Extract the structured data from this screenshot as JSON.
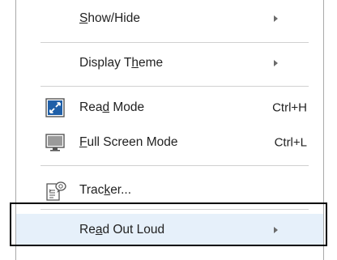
{
  "menu": {
    "items": [
      {
        "label_pre": "",
        "label_u": "S",
        "label_post": "how/Hide",
        "shortcut": "",
        "has_submenu": true,
        "icon": ""
      },
      {
        "label_pre": "Display T",
        "label_u": "h",
        "label_post": "eme",
        "shortcut": "",
        "has_submenu": true,
        "icon": ""
      },
      {
        "label_pre": "Rea",
        "label_u": "d",
        "label_post": " Mode",
        "shortcut": "Ctrl+H",
        "has_submenu": false,
        "icon": "read-mode-icon"
      },
      {
        "label_pre": "",
        "label_u": "F",
        "label_post": "ull Screen Mode",
        "shortcut": "Ctrl+L",
        "has_submenu": false,
        "icon": "full-screen-icon"
      },
      {
        "label_pre": "Trac",
        "label_u": "k",
        "label_post": "er...",
        "shortcut": "",
        "has_submenu": false,
        "icon": "tracker-icon"
      },
      {
        "label_pre": "Re",
        "label_u": "a",
        "label_post": "d Out Loud",
        "shortcut": "",
        "has_submenu": true,
        "icon": ""
      }
    ]
  },
  "colors": {
    "highlight_bg": "#e6f0fa",
    "callout_border": "#000000",
    "icon_blue": "#1f5fa8"
  }
}
